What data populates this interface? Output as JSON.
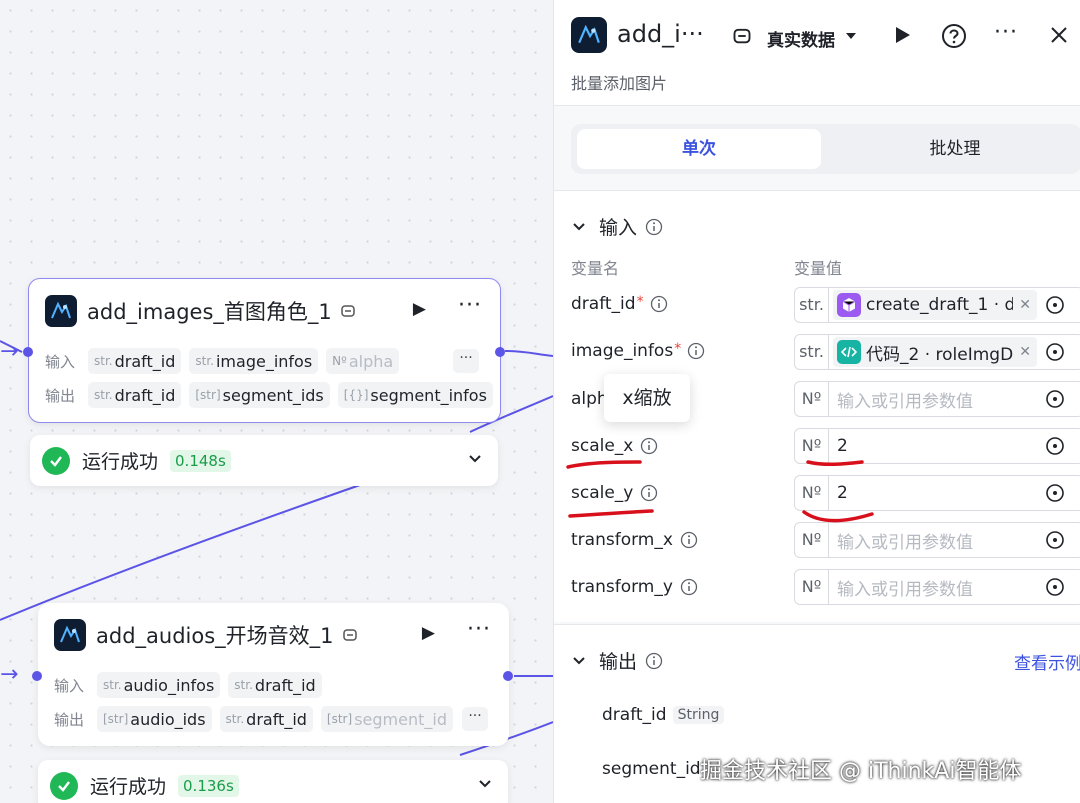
{
  "canvas": {
    "nodes": [
      {
        "title": "add_images_首图角色_1",
        "input_label": "输入",
        "output_label": "输出",
        "inputs": [
          {
            "type": "str.",
            "name": "draft_id"
          },
          {
            "type": "str.",
            "name": "image_infos"
          },
          {
            "type": "Nº",
            "name": "alpha"
          }
        ],
        "outputs": [
          {
            "type": "str.",
            "name": "draft_id"
          },
          {
            "type": "[str]",
            "name": "segment_ids"
          },
          {
            "type": "[{}]",
            "name": "segment_infos"
          }
        ],
        "status": "运行成功",
        "time": "0.148s"
      },
      {
        "title": "add_audios_开场音效_1",
        "input_label": "输入",
        "output_label": "输出",
        "inputs": [
          {
            "type": "str.",
            "name": "audio_infos"
          },
          {
            "type": "str.",
            "name": "draft_id"
          }
        ],
        "outputs": [
          {
            "type": "[str]",
            "name": "audio_ids"
          },
          {
            "type": "str.",
            "name": "draft_id"
          },
          {
            "type": "[str]",
            "name": "segment_id"
          }
        ],
        "status": "运行成功",
        "time": "0.136s"
      }
    ]
  },
  "panel": {
    "title": "add_i···",
    "mode": "真实数据",
    "subtitle": "批量添加图片",
    "tabs": {
      "single": "单次",
      "batch": "批处理"
    },
    "input_section": "输入",
    "col_name": "变量名",
    "col_value": "变量值",
    "params": [
      {
        "name": "draft_id",
        "required": true,
        "type": "str.",
        "ref": "create_draft_1 · d···"
      },
      {
        "name": "image_infos",
        "required": true,
        "type": "str.",
        "ref": "代码_2 · roleImgD···"
      },
      {
        "name": "alph",
        "required": false,
        "type": "Nº",
        "placeholder": "输入或引用参数值"
      },
      {
        "name": "scale_x",
        "required": false,
        "type": "Nº",
        "value": "2"
      },
      {
        "name": "scale_y",
        "required": false,
        "type": "Nº",
        "value": "2"
      },
      {
        "name": "transform_x",
        "required": false,
        "type": "Nº",
        "placeholder": "输入或引用参数值"
      },
      {
        "name": "transform_y",
        "required": false,
        "type": "Nº",
        "placeholder": "输入或引用参数值"
      }
    ],
    "tooltip": "x缩放",
    "output_section": "输出",
    "output_link": "查看示例",
    "outputs": [
      {
        "name": "draft_id",
        "type": "String"
      },
      {
        "name": "segment_id"
      }
    ]
  },
  "watermark": "掘金技术社区 @ iThinkAi智能体",
  "colors": {
    "accent": "#5b54e6",
    "success": "#20b756",
    "link": "#3d53e0",
    "annotation": "#d8101c"
  }
}
